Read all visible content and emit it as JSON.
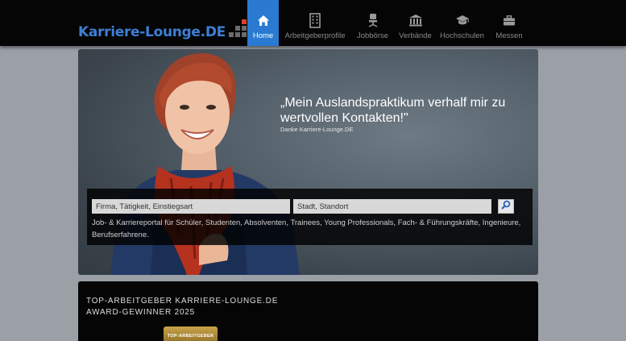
{
  "header": {
    "logo_text": "Karriere-Lounge.DE",
    "nav": [
      {
        "label": "Home",
        "icon": "home-icon",
        "active": true
      },
      {
        "label": "Arbeitgeberprofile",
        "icon": "building-icon",
        "active": false
      },
      {
        "label": "Jobbörse",
        "icon": "office-chair-icon",
        "active": false
      },
      {
        "label": "Verbände",
        "icon": "institution-icon",
        "active": false
      },
      {
        "label": "Hochschulen",
        "icon": "graduation-cap-icon",
        "active": false
      },
      {
        "label": "Messen",
        "icon": "briefcase-icon",
        "active": false
      }
    ]
  },
  "hero": {
    "quote": "„Mein Auslandspraktikum verhalf mir zu wertvollen Kontakten!\"",
    "quote_sub": "Danke Karriere-Lounge.DE",
    "search": {
      "what_placeholder": "Firma, Tätigkeit, Einstiegsart",
      "where_placeholder": "Stadt, Standort",
      "button_icon": "search-icon",
      "description": "Job- & Karriereportal für Schüler, Studenten, Absolventen, Trainees, Young Professionals, Fach- & Führungskräfte, Ingenieure, Berufserfahrene."
    }
  },
  "award": {
    "title_line1": "TOP-ARBEITGEBER KARRIERE-LOUNGE.DE",
    "title_line2": "AWARD-GEWINNER 2025",
    "badge_text": "TOP-ARBEITGEBER"
  },
  "colors": {
    "accent": "#2a7ad1",
    "logo_blue": "#3d7fd4",
    "logo_red": "#d9412b",
    "topbar": "#050505"
  }
}
